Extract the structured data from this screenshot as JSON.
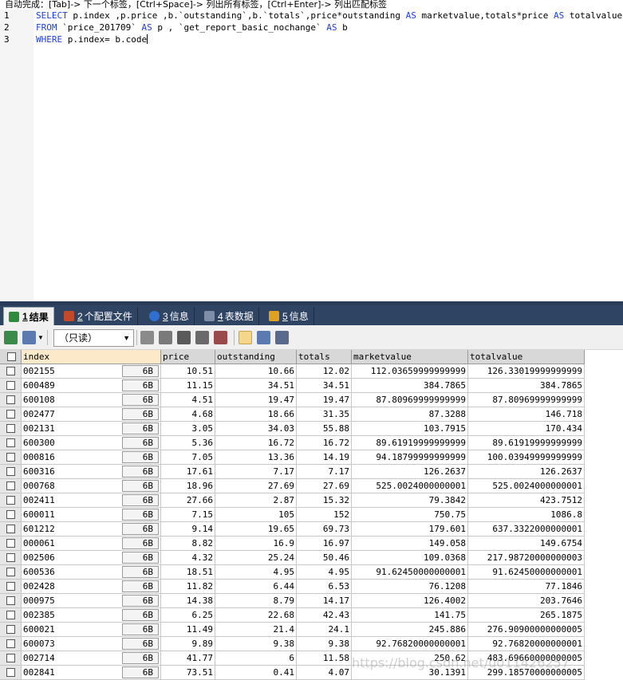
{
  "editor": {
    "hint": "自动完成：[Tab]-> 下一个标签，[Ctrl+Space]-> 列出所有标签，[Ctrl+Enter]-> 列出匹配标签",
    "line_numbers": [
      "1",
      "2",
      "3"
    ],
    "lines": [
      [
        {
          "t": "SELECT",
          "kw": true
        },
        {
          "t": " p.index ,p.price ,b.`outstanding`,b.`totals`,price*outstanding ",
          "kw": false
        },
        {
          "t": "AS",
          "kw": true
        },
        {
          "t": " marketvalue,totals*price ",
          "kw": false
        },
        {
          "t": "AS",
          "kw": true
        },
        {
          "t": " totalvalue",
          "kw": false
        }
      ],
      [
        {
          "t": "FROM",
          "kw": true
        },
        {
          "t": " `price_201709` ",
          "kw": false
        },
        {
          "t": "AS",
          "kw": true
        },
        {
          "t": " p , `get_report_basic_nochange` ",
          "kw": false
        },
        {
          "t": "AS",
          "kw": true
        },
        {
          "t": " b",
          "kw": false
        }
      ],
      [
        {
          "t": "WHERE",
          "kw": true
        },
        {
          "t": " p.index= b.code",
          "kw": false
        }
      ]
    ]
  },
  "tabs": [
    {
      "num": "1",
      "label": "结果",
      "icon": "result-table-icon",
      "color": "#2e8b3d",
      "active": true
    },
    {
      "num": "2",
      "label": "个配置文件",
      "icon": "profile-icon",
      "color": "#c24a2a",
      "active": false
    },
    {
      "num": "3",
      "label": "信息",
      "icon": "info-icon",
      "color": "#2f6fd0",
      "active": false
    },
    {
      "num": "4",
      "label": "表数据",
      "icon": "table-data-icon",
      "color": "#7f8ea8",
      "active": false
    },
    {
      "num": "5",
      "label": "信息",
      "icon": "info-chart-icon",
      "color": "#e0a020",
      "active": false
    }
  ],
  "toolbar": {
    "mode": "（只读）"
  },
  "grid": {
    "columns": [
      "index",
      "price",
      "outstanding",
      "totals",
      "marketvalue",
      "totalvalue"
    ],
    "blob_label": "6B",
    "rows": [
      [
        "002155",
        "10.51",
        "10.66",
        "12.02",
        "112.03659999999999",
        "126.33019999999999"
      ],
      [
        "600489",
        "11.15",
        "34.51",
        "34.51",
        "384.7865",
        "384.7865"
      ],
      [
        "600108",
        "4.51",
        "19.47",
        "19.47",
        "87.80969999999999",
        "87.80969999999999"
      ],
      [
        "002477",
        "4.68",
        "18.66",
        "31.35",
        "87.3288",
        "146.718"
      ],
      [
        "002131",
        "3.05",
        "34.03",
        "55.88",
        "103.7915",
        "170.434"
      ],
      [
        "600300",
        "5.36",
        "16.72",
        "16.72",
        "89.61919999999999",
        "89.61919999999999"
      ],
      [
        "000816",
        "7.05",
        "13.36",
        "14.19",
        "94.18799999999999",
        "100.03949999999999"
      ],
      [
        "600316",
        "17.61",
        "7.17",
        "7.17",
        "126.2637",
        "126.2637"
      ],
      [
        "000768",
        "18.96",
        "27.69",
        "27.69",
        "525.0024000000001",
        "525.0024000000001"
      ],
      [
        "002411",
        "27.66",
        "2.87",
        "15.32",
        "79.3842",
        "423.7512"
      ],
      [
        "600011",
        "7.15",
        "105",
        "152",
        "750.75",
        "1086.8"
      ],
      [
        "601212",
        "9.14",
        "19.65",
        "69.73",
        "179.601",
        "637.3322000000001"
      ],
      [
        "000061",
        "8.82",
        "16.9",
        "16.97",
        "149.058",
        "149.6754"
      ],
      [
        "002506",
        "4.32",
        "25.24",
        "50.46",
        "109.0368",
        "217.98720000000003"
      ],
      [
        "600536",
        "18.51",
        "4.95",
        "4.95",
        "91.62450000000001",
        "91.62450000000001"
      ],
      [
        "002428",
        "11.82",
        "6.44",
        "6.53",
        "76.1208",
        "77.1846"
      ],
      [
        "000975",
        "14.38",
        "8.79",
        "14.17",
        "126.4002",
        "203.7646"
      ],
      [
        "002385",
        "6.25",
        "22.68",
        "42.43",
        "141.75",
        "265.1875"
      ],
      [
        "600021",
        "11.49",
        "21.4",
        "24.1",
        "245.886",
        "276.90900000000005"
      ],
      [
        "600073",
        "9.89",
        "9.38",
        "9.38",
        "92.76820000000001",
        "92.76820000000001"
      ],
      [
        "002714",
        "41.77",
        "6",
        "11.58",
        "250.62",
        "483.69660000000005"
      ],
      [
        "002841",
        "73.51",
        "0.41",
        "4.07",
        "30.1391",
        "299.18570000000005"
      ]
    ]
  },
  "watermark": "https://blog.csdn.net/u011426257"
}
